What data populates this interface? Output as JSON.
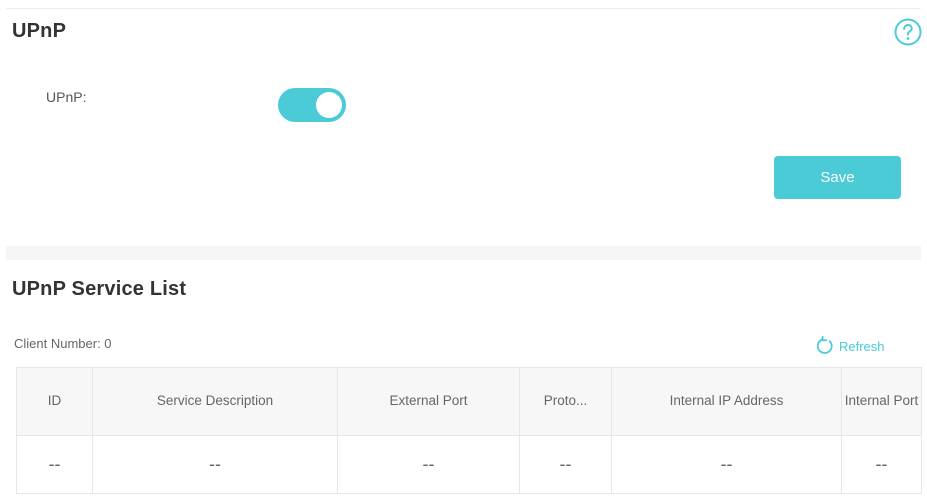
{
  "upnp_section": {
    "title": "UPnP",
    "toggle_label": "UPnP:",
    "toggle_enabled": true,
    "save_label": "Save",
    "accent_color": "#4acbd6",
    "help_icon": "question-circle-icon"
  },
  "service_list": {
    "title": "UPnP Service List",
    "client_number": "Client Number: 0",
    "refresh_label": "Refresh",
    "refresh_icon": "refresh-icon",
    "columns": [
      "ID",
      "Service Description",
      "External Port",
      "Proto...",
      "Internal IP Address",
      "Internal Port"
    ],
    "rows": [
      [
        "--",
        "--",
        "--",
        "--",
        "--",
        "--"
      ]
    ]
  }
}
